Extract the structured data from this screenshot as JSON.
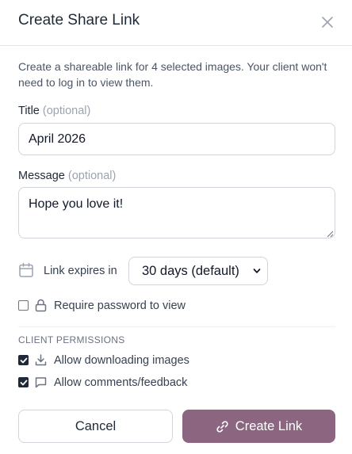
{
  "dialog": {
    "title": "Create Share Link",
    "description": "Create a shareable link for 4 selected images. Your client won't need to log in to view them."
  },
  "fields": {
    "title_label": "Title",
    "title_optional": "(optional)",
    "title_value": "April 2026",
    "message_label": "Message",
    "message_optional": "(optional)",
    "message_value": "Hope you love it!"
  },
  "expiry": {
    "label": "Link expires in",
    "selected": "30 days (default)"
  },
  "password": {
    "label": "Require password to view",
    "checked": false
  },
  "permissions": {
    "heading": "CLIENT PERMISSIONS",
    "items": [
      {
        "label": "Allow downloading images",
        "checked": true,
        "icon": "download-icon"
      },
      {
        "label": "Allow comments/feedback",
        "checked": true,
        "icon": "comment-icon"
      }
    ]
  },
  "actions": {
    "cancel": "Cancel",
    "create": "Create Link"
  },
  "colors": {
    "primary": "#8c6680",
    "text": "#1f2937",
    "muted": "#9ca3af"
  }
}
